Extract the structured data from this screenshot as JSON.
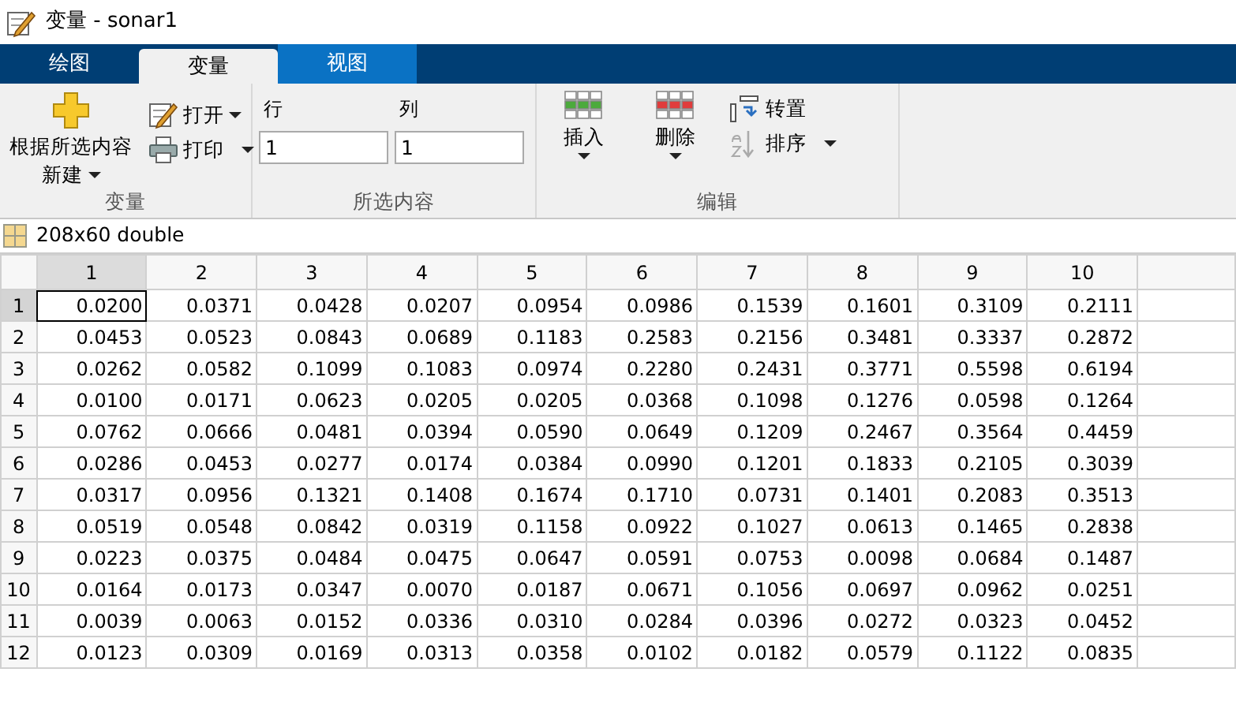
{
  "window": {
    "title": "变量 - sonar1"
  },
  "tabs": [
    {
      "label": "绘图",
      "selected": false,
      "highlighted": false
    },
    {
      "label": "变量",
      "selected": true,
      "highlighted": false
    },
    {
      "label": "视图",
      "selected": false,
      "highlighted": true
    }
  ],
  "ribbon": {
    "groups": [
      {
        "label": "变量",
        "kind": "variable",
        "new_button": {
          "lines": [
            "根据所选内容",
            "新建"
          ]
        },
        "open_button": {
          "label": "打开"
        },
        "print_button": {
          "label": "打印"
        }
      },
      {
        "label": "所选内容",
        "kind": "selection",
        "row_field": {
          "label": "行",
          "value": "1"
        },
        "column_field": {
          "label": "列",
          "value": "1"
        }
      },
      {
        "label": "编辑",
        "kind": "edit",
        "insert_button": {
          "label": "插入"
        },
        "delete_button": {
          "label": "删除"
        },
        "transpose_button": {
          "label": "转置"
        },
        "sort_button": {
          "label": "排序"
        }
      }
    ]
  },
  "variable_info": "208x60 double",
  "table": {
    "columns": [
      {
        "label": "1",
        "selected": true
      },
      {
        "label": "2",
        "selected": false
      },
      {
        "label": "3",
        "selected": false
      },
      {
        "label": "4",
        "selected": false
      },
      {
        "label": "5",
        "selected": false
      },
      {
        "label": "6",
        "selected": false
      },
      {
        "label": "7",
        "selected": false
      },
      {
        "label": "8",
        "selected": false
      },
      {
        "label": "9",
        "selected": false
      },
      {
        "label": "10",
        "selected": false
      }
    ],
    "rows": [
      {
        "header": "1",
        "selected": true,
        "cells": [
          "0.0200",
          "0.0371",
          "0.0428",
          "0.0207",
          "0.0954",
          "0.0986",
          "0.1539",
          "0.1601",
          "0.3109",
          "0.2111"
        ]
      },
      {
        "header": "2",
        "selected": false,
        "cells": [
          "0.0453",
          "0.0523",
          "0.0843",
          "0.0689",
          "0.1183",
          "0.2583",
          "0.2156",
          "0.3481",
          "0.3337",
          "0.2872"
        ]
      },
      {
        "header": "3",
        "selected": false,
        "cells": [
          "0.0262",
          "0.0582",
          "0.1099",
          "0.1083",
          "0.0974",
          "0.2280",
          "0.2431",
          "0.3771",
          "0.5598",
          "0.6194"
        ]
      },
      {
        "header": "4",
        "selected": false,
        "cells": [
          "0.0100",
          "0.0171",
          "0.0623",
          "0.0205",
          "0.0205",
          "0.0368",
          "0.1098",
          "0.1276",
          "0.0598",
          "0.1264"
        ]
      },
      {
        "header": "5",
        "selected": false,
        "cells": [
          "0.0762",
          "0.0666",
          "0.0481",
          "0.0394",
          "0.0590",
          "0.0649",
          "0.1209",
          "0.2467",
          "0.3564",
          "0.4459"
        ]
      },
      {
        "header": "6",
        "selected": false,
        "cells": [
          "0.0286",
          "0.0453",
          "0.0277",
          "0.0174",
          "0.0384",
          "0.0990",
          "0.1201",
          "0.1833",
          "0.2105",
          "0.3039"
        ]
      },
      {
        "header": "7",
        "selected": false,
        "cells": [
          "0.0317",
          "0.0956",
          "0.1321",
          "0.1408",
          "0.1674",
          "0.1710",
          "0.0731",
          "0.1401",
          "0.2083",
          "0.3513"
        ]
      },
      {
        "header": "8",
        "selected": false,
        "cells": [
          "0.0519",
          "0.0548",
          "0.0842",
          "0.0319",
          "0.1158",
          "0.0922",
          "0.1027",
          "0.0613",
          "0.1465",
          "0.2838"
        ]
      },
      {
        "header": "9",
        "selected": false,
        "cells": [
          "0.0223",
          "0.0375",
          "0.0484",
          "0.0475",
          "0.0647",
          "0.0591",
          "0.0753",
          "0.0098",
          "0.0684",
          "0.1487"
        ]
      },
      {
        "header": "10",
        "selected": false,
        "cells": [
          "0.0164",
          "0.0173",
          "0.0347",
          "0.0070",
          "0.0187",
          "0.0671",
          "0.1056",
          "0.0697",
          "0.0962",
          "0.0251"
        ]
      },
      {
        "header": "11",
        "selected": false,
        "cells": [
          "0.0039",
          "0.0063",
          "0.0152",
          "0.0336",
          "0.0310",
          "0.0284",
          "0.0396",
          "0.0272",
          "0.0323",
          "0.0452"
        ]
      },
      {
        "header": "12",
        "selected": false,
        "cells": [
          "0.0123",
          "0.0309",
          "0.0169",
          "0.0313",
          "0.0358",
          "0.0102",
          "0.0182",
          "0.0579",
          "0.1122",
          "0.0835"
        ]
      }
    ]
  }
}
